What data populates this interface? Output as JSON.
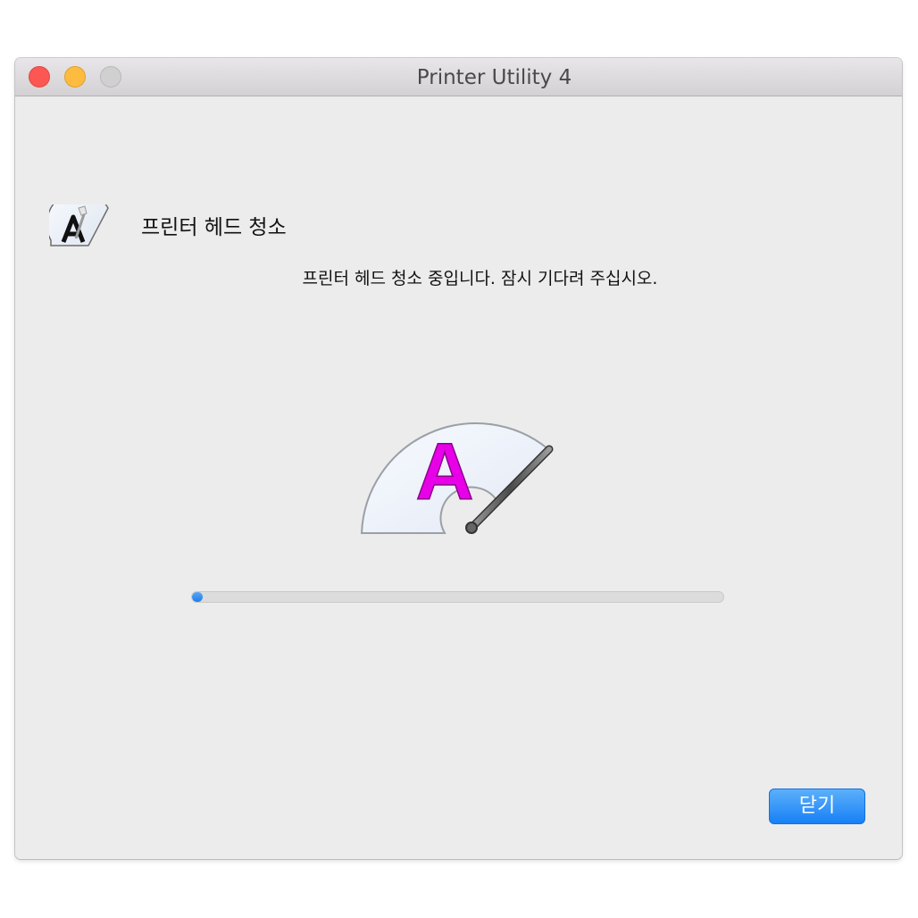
{
  "window": {
    "title": "Printer Utility 4"
  },
  "dialog": {
    "heading": "프린터 헤드 청소",
    "message": "프린터 헤드 청소 중입니다. 잠시 기다려 주십시오.",
    "illustration_letter": "A",
    "progress": 0.02,
    "close_label": "닫기"
  },
  "colors": {
    "accent": "#1f7ce8",
    "letter": "#e800e8",
    "close_light": "#fc5753",
    "minimize_light": "#fdbc40",
    "maximize_light": "#d0d0d0"
  },
  "icons": {
    "app_icon": "printhead-cleaning-icon",
    "illustration": "printhead-wiper-illustration"
  }
}
